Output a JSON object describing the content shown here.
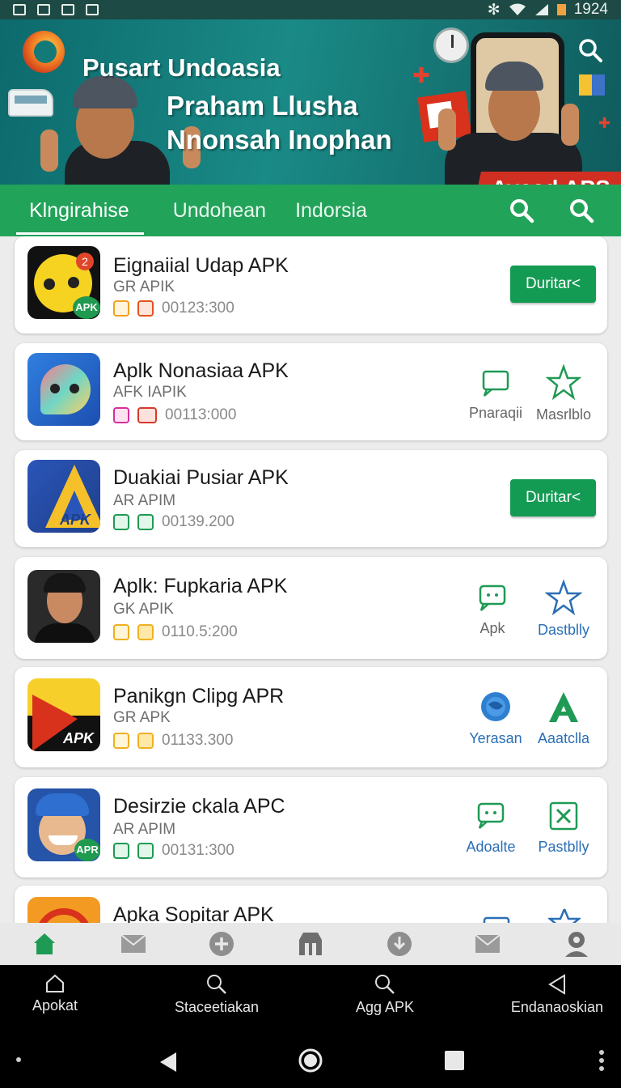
{
  "status_bar": {
    "time": "1924"
  },
  "banner": {
    "title": "Pusart Undoasia",
    "line1": "Praham Llusha",
    "line2": "Nnonsah Inophan",
    "badge": "Aveed APS"
  },
  "tabs": [
    {
      "label": "Klngirahise",
      "active": true
    },
    {
      "label": "Undohean",
      "active": false
    },
    {
      "label": "Indorsia",
      "active": false
    }
  ],
  "apps": [
    {
      "name": "Eignaiial Udap APK",
      "sub": "GR APIK",
      "meta": "00123:300",
      "button": "Duritar<"
    },
    {
      "name": "Aplk Nonasiaa APK",
      "sub": "AFK IAPIK",
      "meta": "00113:000",
      "actions": [
        "Pnaraqii",
        "Masrlblo"
      ]
    },
    {
      "name": "Duakiai Pusiar APK",
      "sub": "AR APIM",
      "meta": "00139.200",
      "button": "Duritar<"
    },
    {
      "name": "Aplk: Fupkaria APK",
      "sub": "GK APIK",
      "meta": "0110.5:200",
      "actions": [
        "Apk",
        "Dastblly"
      ]
    },
    {
      "name": "Panikgn Clipg APR",
      "sub": "GR APK",
      "meta": "01133.300",
      "actions": [
        "Yerasan",
        "Aaatclla"
      ]
    },
    {
      "name": "Desirzie ckala APC",
      "sub": "AR APIM",
      "meta": "00131:300",
      "actions": [
        "Adoalte",
        "Pastblly"
      ]
    },
    {
      "name": "Apka Sopitar APK"
    }
  ],
  "icon_labels": {
    "apk": "APK",
    "apr": "APR"
  },
  "footer": [
    {
      "label": "Apokat",
      "icon": "home-icon"
    },
    {
      "label": "Staceetiakan",
      "icon": "search-icon"
    },
    {
      "label": "Agg APK",
      "icon": "search-icon"
    },
    {
      "label": "Endanaoskian",
      "icon": "back-icon"
    }
  ],
  "colors": {
    "primary": "#22a35a",
    "button": "#139a53",
    "banner": "#147a78",
    "link": "#2a6fb5"
  }
}
